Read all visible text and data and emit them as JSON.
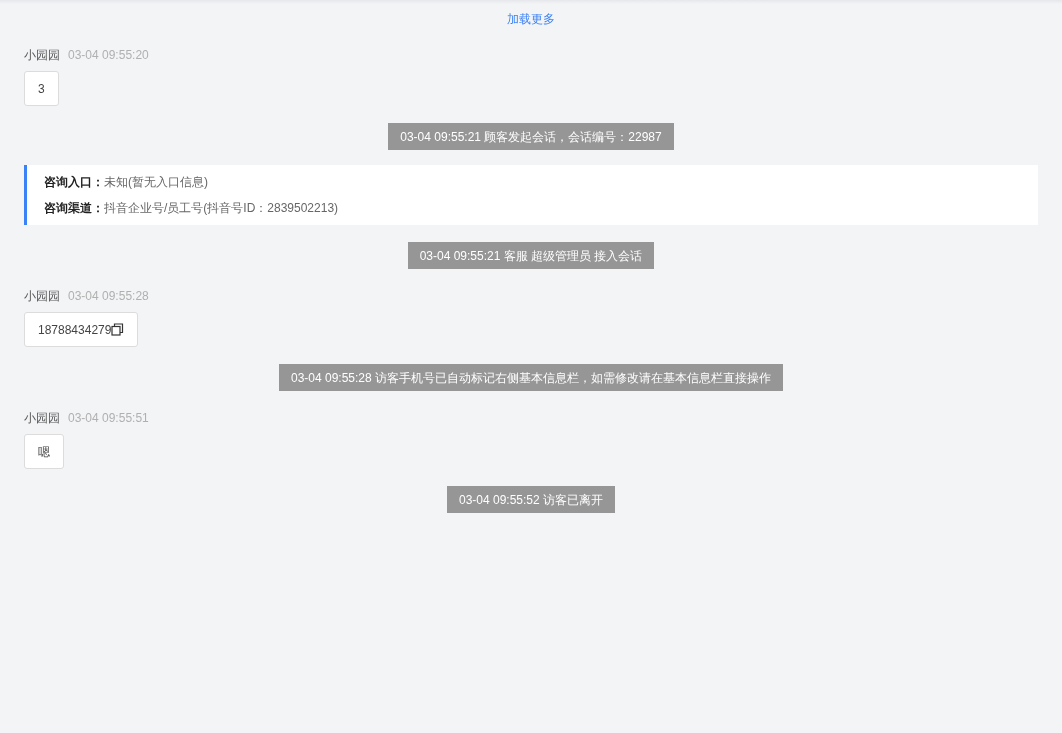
{
  "load_more": "加载更多",
  "items": [
    {
      "kind": "message",
      "sender": "小园园",
      "time": "03-04 09:55:20",
      "text": "3",
      "copyable": false
    },
    {
      "kind": "system",
      "text": "03-04 09:55:21 顾客发起会话，会话编号：22987"
    },
    {
      "kind": "info",
      "rows": [
        {
          "label": "咨询入口：",
          "value": "未知(暂无入口信息)"
        },
        {
          "label": "咨询渠道：",
          "value": "抖音企业号/员工号(抖音号ID：2839502213)"
        }
      ]
    },
    {
      "kind": "system",
      "text": "03-04 09:55:21 客服 超级管理员 接入会话"
    },
    {
      "kind": "message",
      "sender": "小园园",
      "time": "03-04 09:55:28",
      "text": "18788434279",
      "copyable": true
    },
    {
      "kind": "system",
      "text": "03-04 09:55:28 访客手机号已自动标记右侧基本信息栏，如需修改请在基本信息栏直接操作"
    },
    {
      "kind": "message",
      "sender": "小园园",
      "time": "03-04 09:55:51",
      "text": "嗯",
      "copyable": false
    },
    {
      "kind": "system",
      "text": "03-04 09:55:52 访客已离开"
    }
  ]
}
